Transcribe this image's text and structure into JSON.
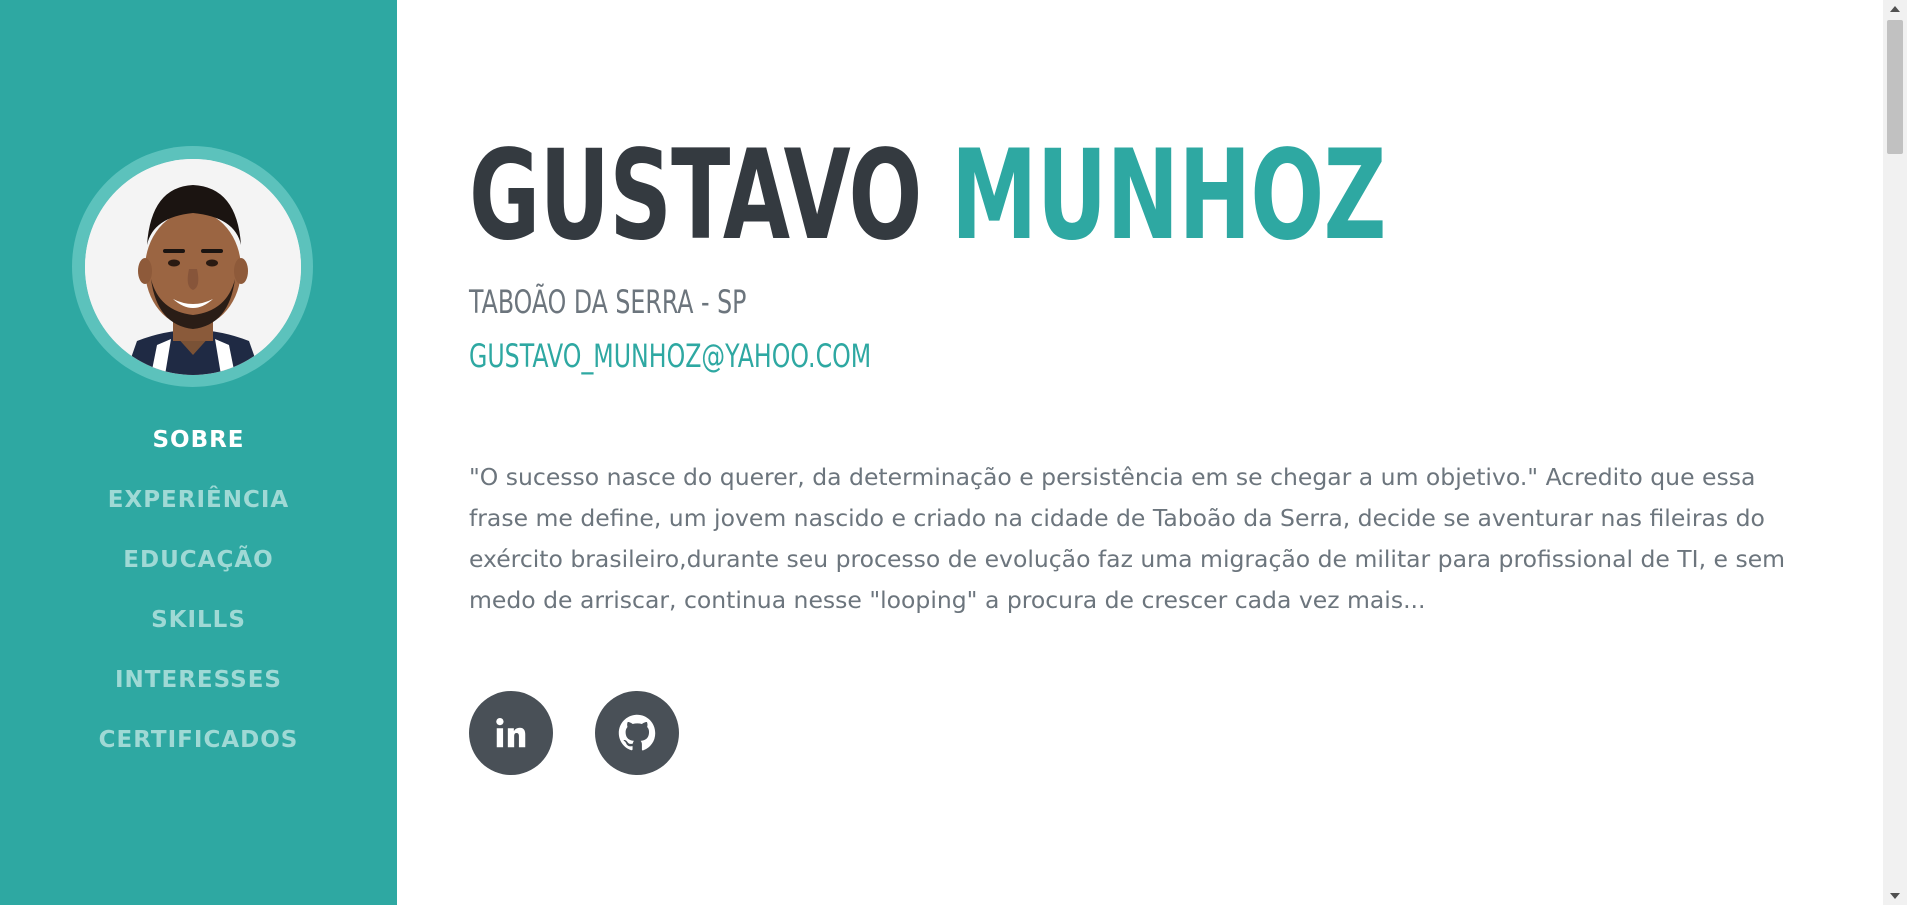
{
  "colors": {
    "accent": "#2ea8a2",
    "sidebar_bg": "#2ea8a2",
    "nav_inactive": "#9fd9d5",
    "dark": "#343a40",
    "text_muted": "#6c757d",
    "social_bg": "#495057"
  },
  "sidebar": {
    "avatar_icon": "profile-photo",
    "nav": [
      {
        "label": "SOBRE",
        "active": true
      },
      {
        "label": "EXPERIÊNCIA",
        "active": false
      },
      {
        "label": "EDUCAÇÃO",
        "active": false
      },
      {
        "label": "SKILLS",
        "active": false
      },
      {
        "label": "INTERESSES",
        "active": false
      },
      {
        "label": "CERTIFICADOS",
        "active": false
      }
    ]
  },
  "profile": {
    "first_name": "GUSTAVO",
    "last_name": "MUNHOZ",
    "location": "TABOÃO DA SERRA - SP",
    "email": "GUSTAVO_MUNHOZ@YAHOO.COM",
    "bio": "\"O sucesso nasce do querer, da determinação e persistência em se chegar a um objetivo.\" Acredito que essa frase me define, um jovem nascido e criado na cidade de Taboão da Serra, decide se aventurar nas fileiras do exército brasileiro,durante seu processo de evolução faz uma migração de militar para profissional de TI, e sem medo de arriscar, continua nesse \"looping\" a procura de crescer cada vez mais..."
  },
  "social": [
    {
      "name": "linkedin",
      "icon": "linkedin-icon"
    },
    {
      "name": "github",
      "icon": "github-icon"
    }
  ]
}
